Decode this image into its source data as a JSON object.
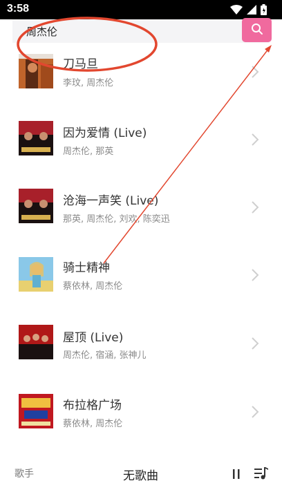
{
  "status_bar": {
    "time": "3:58",
    "icons": [
      "wifi-icon",
      "signal-icon",
      "battery-icon"
    ]
  },
  "search": {
    "query": "周杰伦",
    "button_icon": "search-icon",
    "accent_color": "#f06a9e"
  },
  "songs": [
    {
      "title": "刀马旦",
      "artists": "李玟, 周杰伦"
    },
    {
      "title": "因为爱情 (Live)",
      "artists": "周杰伦, 那英"
    },
    {
      "title": "沧海一声笑 (Live)",
      "artists": "那英, 周杰伦, 刘欢, 陈奕迅"
    },
    {
      "title": "骑士精神",
      "artists": "蔡依林, 周杰伦"
    },
    {
      "title": "屋顶 (Live)",
      "artists": "周杰伦, 宿涵, 张神儿"
    },
    {
      "title": "布拉格广场",
      "artists": "蔡依林, 周杰伦"
    }
  ],
  "bottom_bar": {
    "singer_tab": "歌手",
    "now_playing": "无歌曲",
    "pause_icon": "pause-icon",
    "playlist_icon": "playlist-icon"
  },
  "annotation": {
    "color": "#e2472f",
    "shapes": [
      "ellipse-annotation",
      "arrow-annotation"
    ]
  }
}
